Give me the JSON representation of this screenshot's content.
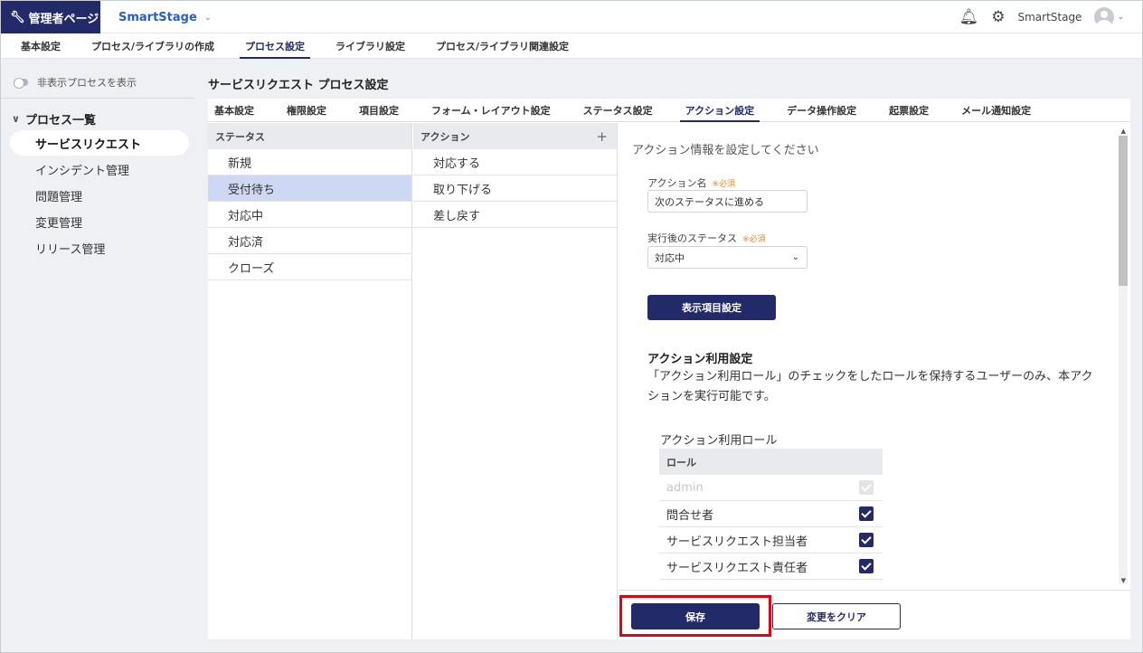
{
  "topbar": {
    "admin_label": "管理者ページ",
    "brand": "SmartStage",
    "user_name": "SmartStage"
  },
  "main_nav": [
    {
      "label": "基本設定",
      "active": false
    },
    {
      "label": "プロセス/ライブラリの作成",
      "active": false
    },
    {
      "label": "プロセス設定",
      "active": true
    },
    {
      "label": "ライブラリ設定",
      "active": false
    },
    {
      "label": "プロセス/ライブラリ関連設定",
      "active": false
    }
  ],
  "sidebar": {
    "toggle_label": "非表示プロセスを表示",
    "group_label": "プロセス一覧",
    "items": [
      {
        "label": "サービスリクエスト",
        "active": true
      },
      {
        "label": "インシデント管理",
        "active": false
      },
      {
        "label": "問題管理",
        "active": false
      },
      {
        "label": "変更管理",
        "active": false
      },
      {
        "label": "リリース管理",
        "active": false
      }
    ]
  },
  "page_title": "サービスリクエスト プロセス設定",
  "sub_tabs": [
    {
      "label": "基本設定",
      "active": false
    },
    {
      "label": "権限設定",
      "active": false
    },
    {
      "label": "項目設定",
      "active": false
    },
    {
      "label": "フォーム・レイアウト設定",
      "active": false
    },
    {
      "label": "ステータス設定",
      "active": false
    },
    {
      "label": "アクション設定",
      "active": true
    },
    {
      "label": "データ操作設定",
      "active": false
    },
    {
      "label": "起票設定",
      "active": false
    },
    {
      "label": "メール通知設定",
      "active": false
    }
  ],
  "status_column": {
    "header": "ステータス",
    "rows": [
      {
        "label": "新規",
        "selected": false
      },
      {
        "label": "受付待ち",
        "selected": true
      },
      {
        "label": "対応中",
        "selected": false
      },
      {
        "label": "対応済",
        "selected": false
      },
      {
        "label": "クローズ",
        "selected": false
      }
    ]
  },
  "action_column": {
    "header": "アクション",
    "add_symbol": "+",
    "rows": [
      {
        "label": "対応する"
      },
      {
        "label": "取り下げる"
      },
      {
        "label": "差し戻す"
      }
    ]
  },
  "detail": {
    "hint": "アクション情報を設定してください",
    "action_name_label": "アクション名",
    "required_mark": "※必須",
    "action_name_value": "次のステータスに進める",
    "next_status_label": "実行後のステータス",
    "next_status_value": "対応中",
    "display_items_button": "表示項目設定",
    "usage_title": "アクション利用設定",
    "usage_desc": "「アクション利用ロール」のチェックをしたロールを保持するユーザーのみ、本アクションを実行可能です。",
    "role_label": "アクション利用ロール",
    "role_header": "ロール",
    "roles": [
      {
        "name": "admin",
        "checked": true,
        "disabled": true
      },
      {
        "name": "問合せ者",
        "checked": true,
        "disabled": false
      },
      {
        "name": "サービスリクエスト担当者",
        "checked": true,
        "disabled": false
      },
      {
        "name": "サービスリクエスト責任者",
        "checked": true,
        "disabled": false
      }
    ]
  },
  "footer": {
    "save_label": "保存",
    "clear_label": "変更をクリア"
  },
  "colors": {
    "primary": "#232a6a",
    "brand": "#2b5cc7",
    "selected_row": "#cfd8f2",
    "required": "#e58a2b",
    "highlight": "#e60012"
  }
}
